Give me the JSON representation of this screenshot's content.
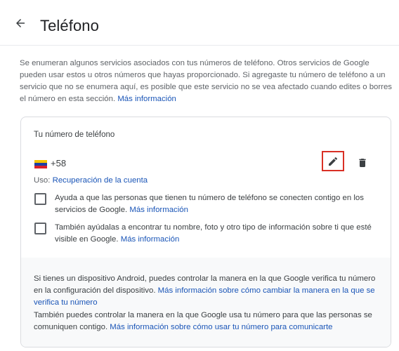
{
  "header": {
    "title": "Teléfono",
    "back_icon": "arrow-back-icon"
  },
  "intro": {
    "text": "Se enumeran algunos servicios asociados con tus números de teléfono. Otros servicios de Google pueden usar estos u otros números que hayas proporcionado. Si agregaste tu número de teléfono a un servicio que no se enumera aquí, es posible que este servicio no se vea afectado cuando edites o borres el número en esta sección.",
    "link": "Más información"
  },
  "phone_card": {
    "title": "Tu número de teléfono",
    "flag_icon": "venezuela-flag-icon",
    "number": "+58",
    "edit_icon": "pencil-icon",
    "delete_icon": "trash-icon",
    "usage_label": "Uso:",
    "usage_link": "Recuperación de la cuenta",
    "options": [
      {
        "checked": false,
        "text": "Ayuda a que las personas que tienen tu número de teléfono se conecten contigo en los servicios de Google.",
        "link": "Más información"
      },
      {
        "checked": false,
        "text": "También ayúdalas a encontrar tu nombre, foto y otro tipo de información sobre ti que esté visible en Google.",
        "link": "Más información"
      }
    ],
    "footer": {
      "p1_text": "Si tienes un dispositivo Android, puedes controlar la manera en la que Google verifica tu número en la configuración del dispositivo.",
      "p1_link": "Más información sobre cómo cambiar la manera en la que se verifica tu número",
      "p2_text": "También puedes controlar la manera en la que Google usa tu número para que las personas se comuniquen contigo.",
      "p2_link": "Más información sobre cómo usar tu número para comunicarte"
    }
  },
  "colors": {
    "link": "#1a55b7",
    "highlight_border": "#d93025",
    "footer_bg": "#f8f9fa"
  }
}
